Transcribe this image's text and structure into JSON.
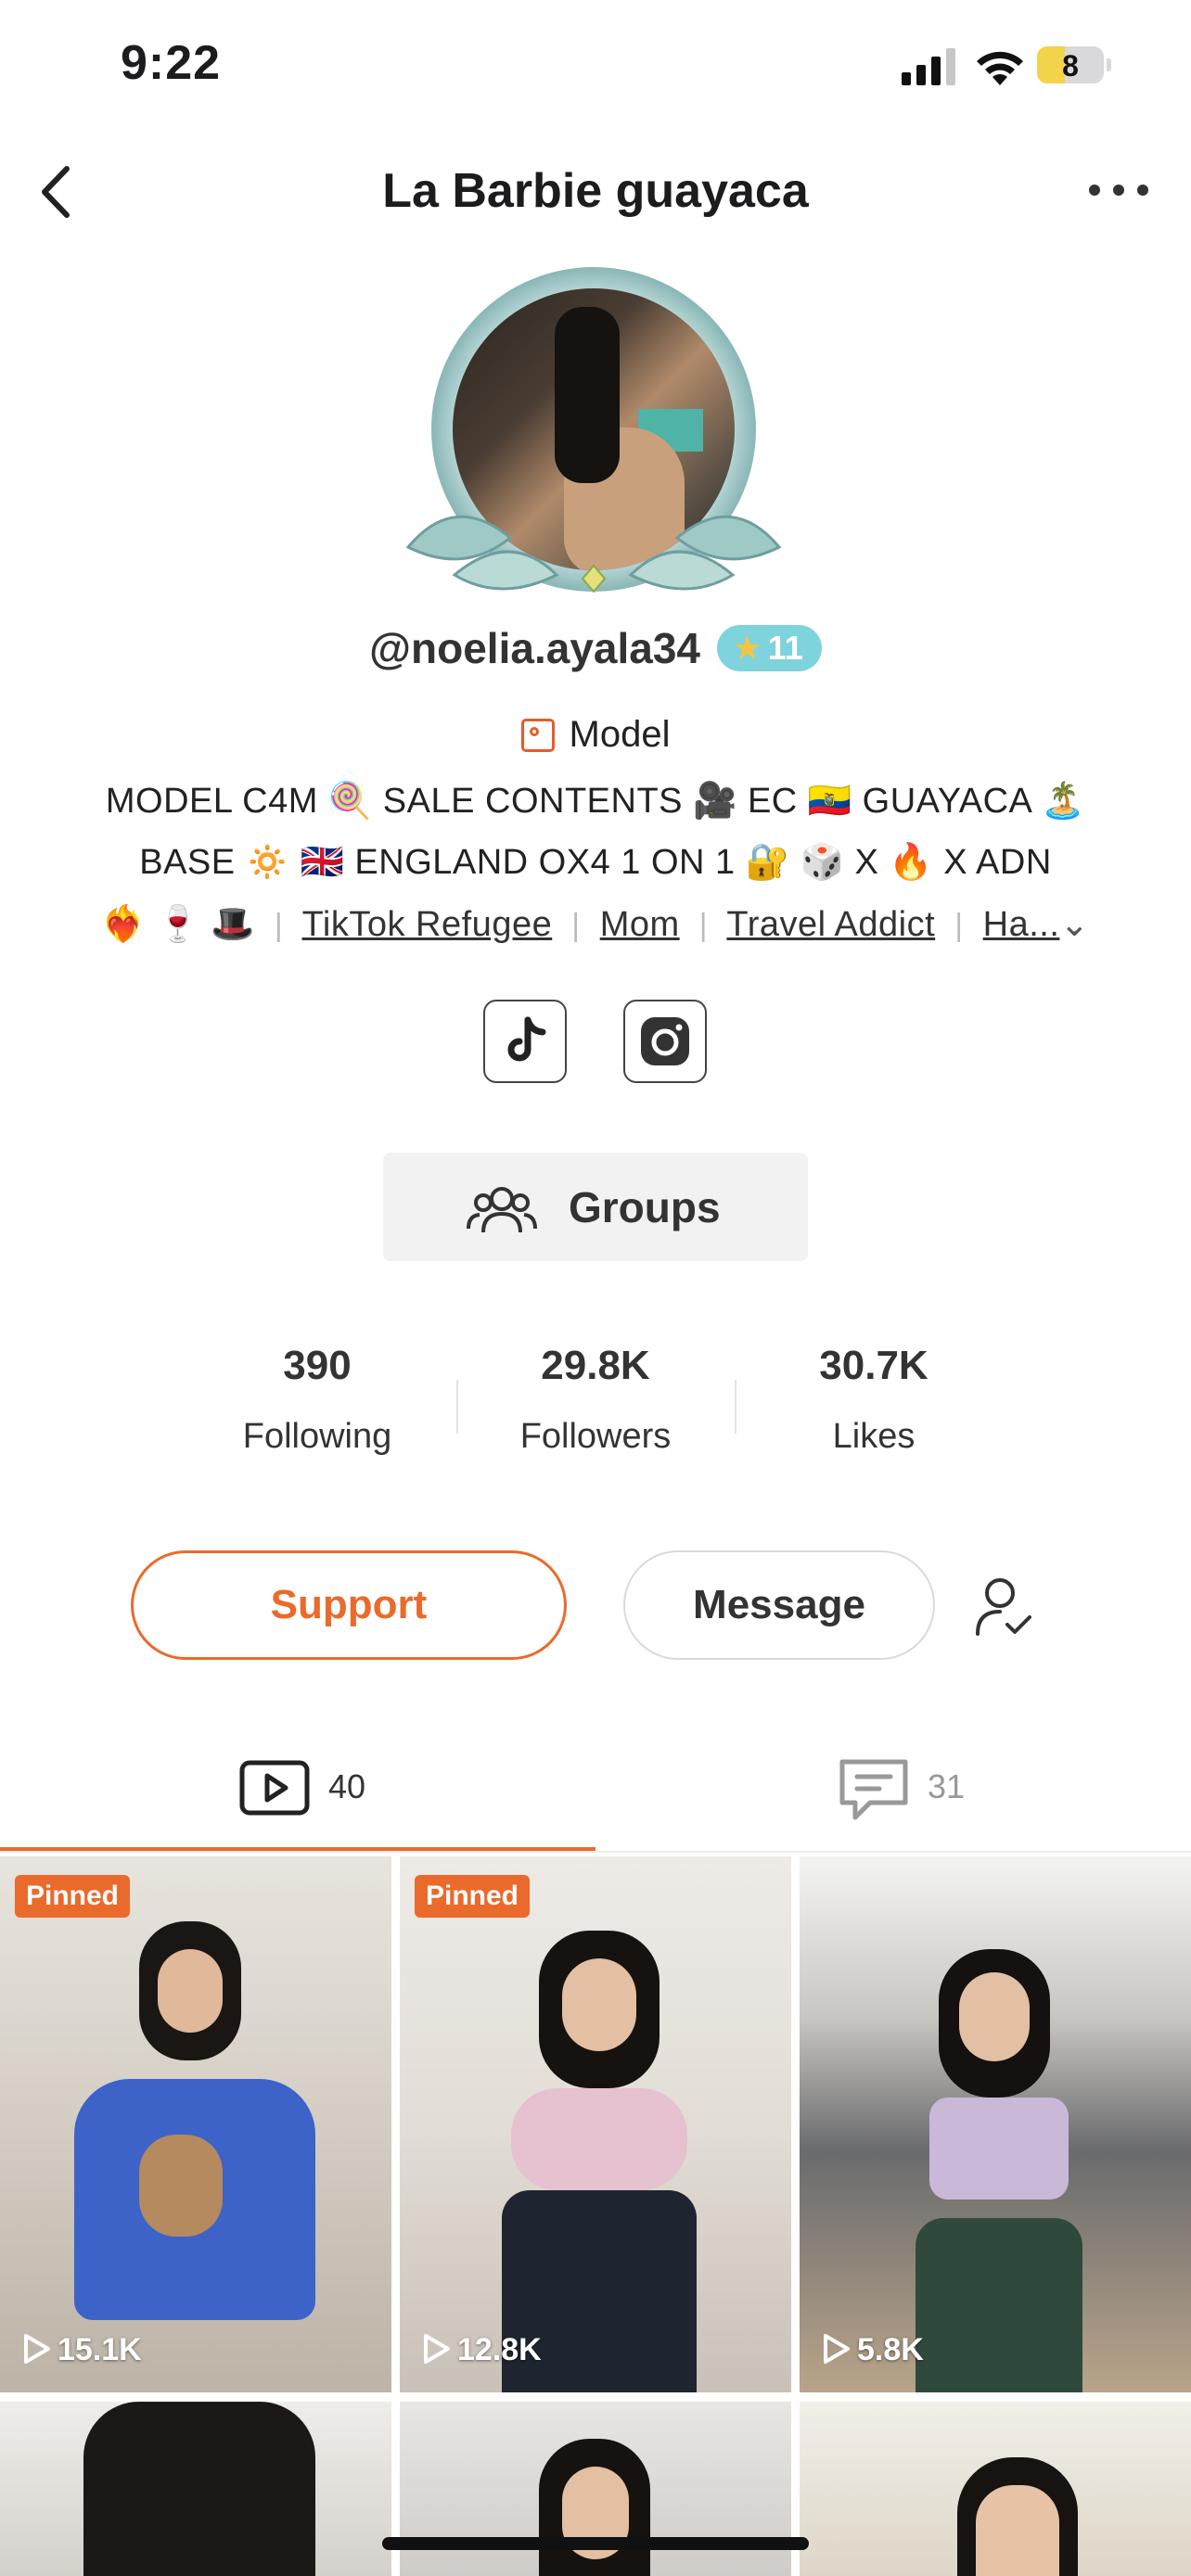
{
  "status_bar": {
    "time": "9:22",
    "battery_level": "8"
  },
  "nav": {
    "title": "La Barbie guayaca",
    "back_icon": "chevron-left-icon",
    "more_icon": "ellipsis-icon"
  },
  "profile": {
    "handle": "@noelia.ayala34",
    "level_badge": "11",
    "role": "Model",
    "bio_line1": "MODEL C4M 🍭 SALE CONTENTS  🎥 EC 🇪🇨 GUAYACA  🏝️",
    "bio_line2": "BASE  🔅 🇬🇧 ENGLAND OX4  1 ON 1 🔐 🎲 X 🔥 X ADN",
    "bio_emojis": "❤️‍🔥 🍷 🎩",
    "bio_tags": [
      "TikTok Refugee",
      "Mom",
      "Travel Addict",
      "Ha..."
    ]
  },
  "groups": {
    "label": "Groups"
  },
  "stats": [
    {
      "value": "390",
      "label": "Following"
    },
    {
      "value": "29.8K",
      "label": "Followers"
    },
    {
      "value": "30.7K",
      "label": "Likes"
    }
  ],
  "actions": {
    "support": "Support",
    "message": "Message"
  },
  "tabs": {
    "videos_count": "40",
    "posts_count": "31"
  },
  "videos": [
    {
      "badge": "Pinned",
      "views": "15.1K"
    },
    {
      "badge": "Pinned",
      "views": "12.8K"
    },
    {
      "badge": "",
      "views": "5.8K"
    }
  ],
  "colors": {
    "accent": "#ea6a2b",
    "level_badge": "#7fd3dc"
  }
}
